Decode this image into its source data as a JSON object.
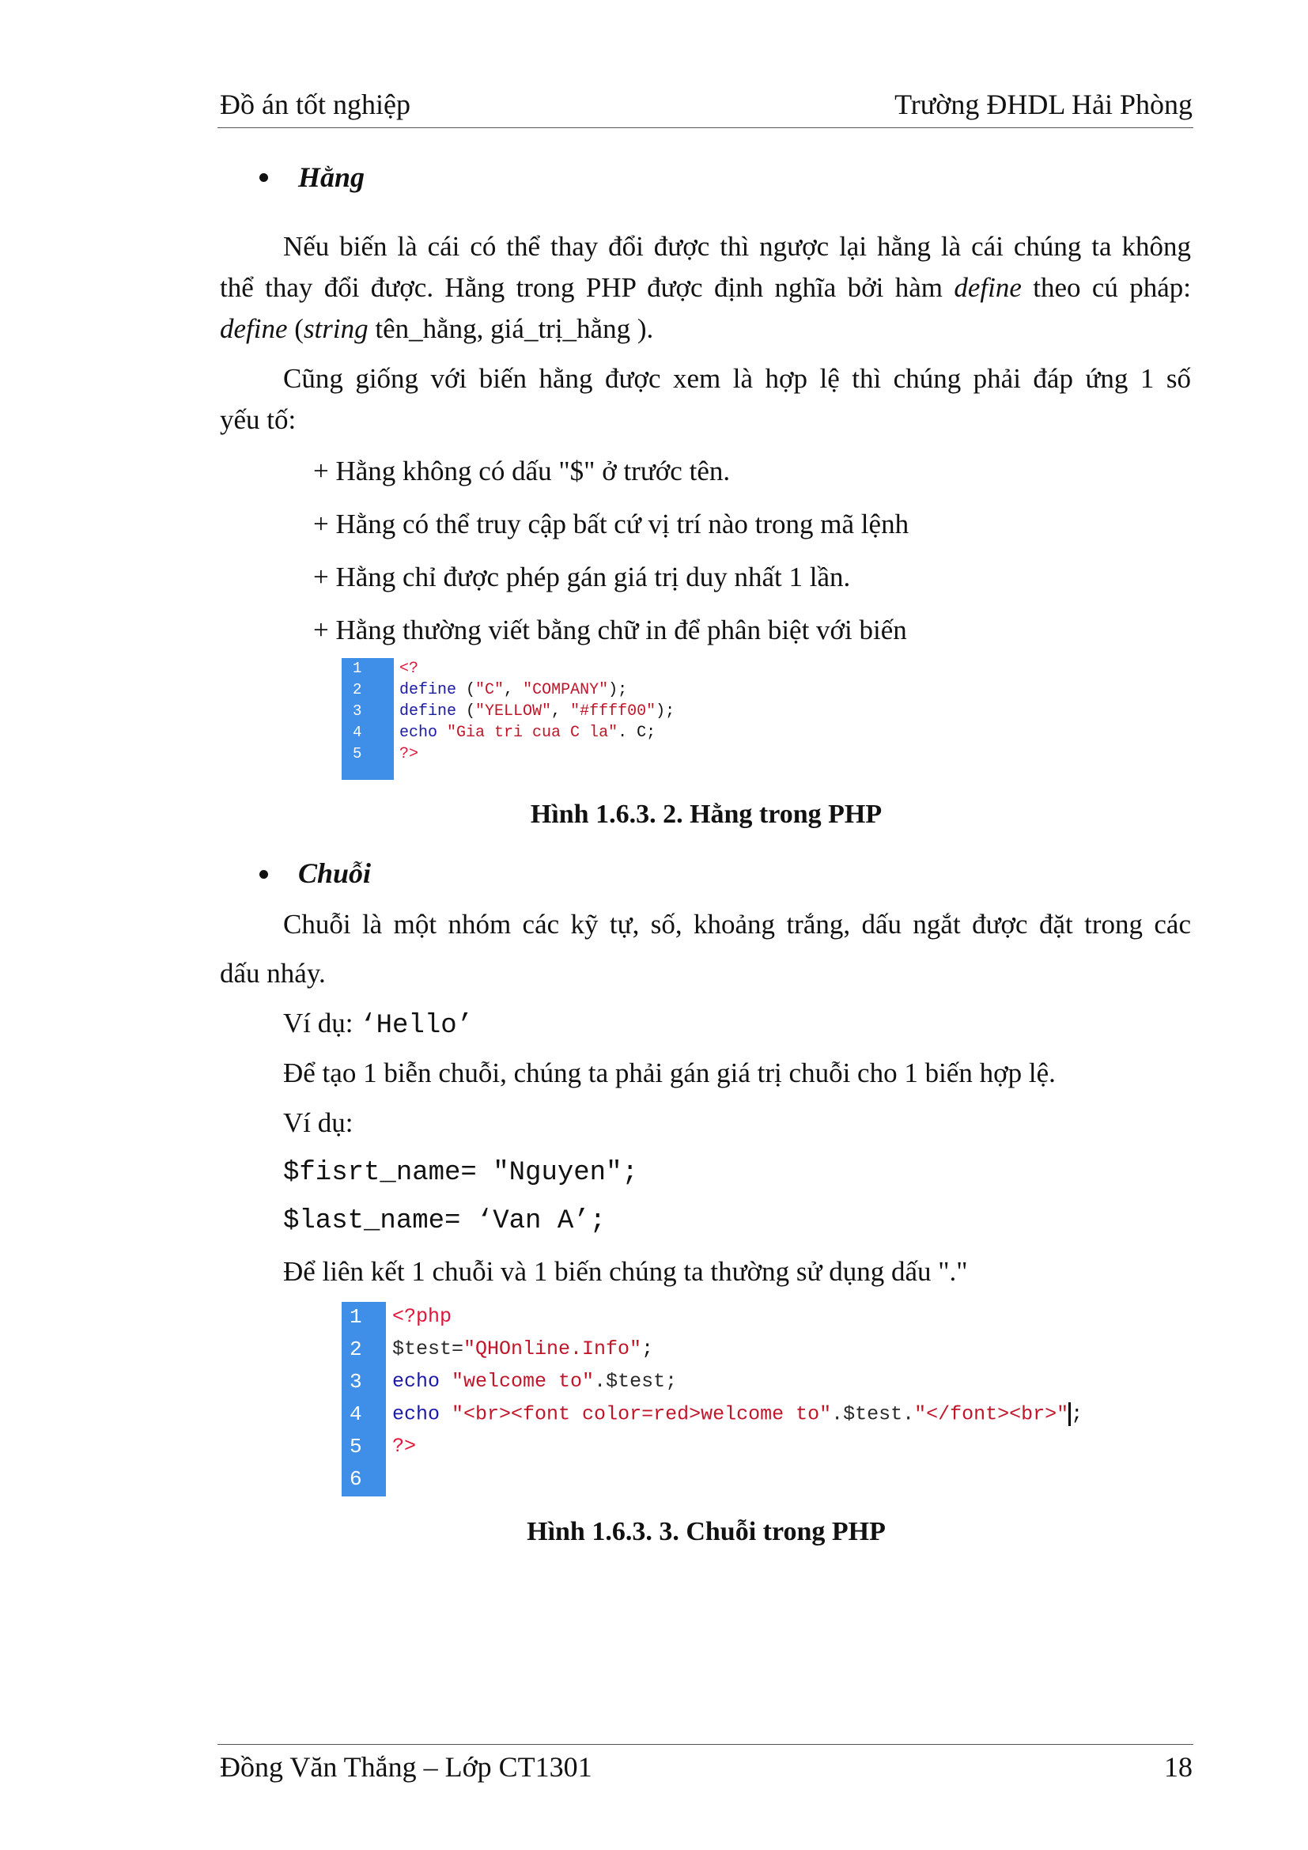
{
  "header": {
    "left": "Đồ án tốt nghiệp",
    "right": "Trường ĐHDL Hải Phòng"
  },
  "sections": {
    "hang": {
      "title": "Hằng",
      "para1": {
        "line1": "Nếu biến là cái có thể thay đổi được thì ngược lại hằng là cái chúng ta không",
        "line2_a": "thể thay đổi được. Hằng trong PHP được định nghĩa bởi hàm ",
        "line2_b": "define",
        "line2_c": " theo cú pháp:",
        "line3_a": "define",
        "line3_b": " (",
        "line3_c": "string",
        "line3_d": " tên_hằng, giá_trị_hằng )."
      },
      "para2": {
        "line1": "Cũng giống với biến hằng được xem là hợp lệ thì chúng phải đáp ứng 1 số",
        "line2": "yếu tố:"
      },
      "rules": [
        "+ Hằng không có dấu \"$\" ở trước tên.",
        "+ Hằng có thể truy cập bất cứ vị trí nào trong mã lệnh",
        "+ Hằng chỉ được phép gán giá trị duy nhất 1 lần.",
        "+ Hằng thường viết bằng chữ in để phân biệt với biến"
      ],
      "code": {
        "line_numbers": [
          "1",
          "2",
          "3",
          "4",
          "5"
        ],
        "l1": "<?",
        "l2_kw": "define",
        "l2_rest_a": " (",
        "l2_s1": "\"C\"",
        "l2_comma": ", ",
        "l2_s2": "\"COMPANY\"",
        "l2_end": ");",
        "l3_kw": "define",
        "l3_rest_a": " (",
        "l3_s1": "\"YELLOW\"",
        "l3_comma": ", ",
        "l3_s2": "\"#ffff00\"",
        "l3_end": ");",
        "l4_kw": "echo",
        "l4_sp": " ",
        "l4_s1": "\"Gia tri cua C la\"",
        "l4_end": ". C;",
        "l5": "?>"
      },
      "caption": "Hình 1.6.3. 2. Hằng trong PHP"
    },
    "chuoi": {
      "title": "Chuỗi",
      "para1": {
        "line1": "Chuỗi là một nhóm các kỹ tự, số, khoảng trắng, dấu ngắt được đặt trong các",
        "line2": "dấu nháy."
      },
      "example1_label": "Ví dụ: ",
      "example1_code": "‘Hello’",
      "para2": "Để tạo 1 biễn chuỗi, chúng ta phải gán giá trị chuỗi cho 1 biến hợp lệ.",
      "example2_label": "Ví dụ:",
      "code_line1": "$fisrt_name= \"Nguyen\";",
      "code_line2": "$last_name=  ‘Van A’;",
      "para3": "Để liên kết 1 chuỗi và 1 biến chúng ta thường sử dụng dấu \".\"",
      "code": {
        "line_numbers": [
          "1",
          "2",
          "3",
          "4",
          "5",
          "6"
        ],
        "l1": "<?php",
        "l2_var": "$test=",
        "l2_str": "\"QHOnline.Info\"",
        "l2_end": ";",
        "l3_kw": "echo",
        "l3_sp": " ",
        "l3_str": "\"welcome to\"",
        "l3_end": ".$test;",
        "l4_kw": "echo",
        "l4_sp": " ",
        "l4_str1": "\"<br><font color=red>welcome to\"",
        "l4_mid": ".$test.",
        "l4_str2": "\"</font><br>\"",
        "l4_end": ";",
        "l5": "?>"
      },
      "caption": "Hình 1.6.3. 3. Chuỗi trong PHP"
    }
  },
  "footer": {
    "left": "Đồng Văn Thắng – Lớp CT1301",
    "page_number": "18"
  }
}
